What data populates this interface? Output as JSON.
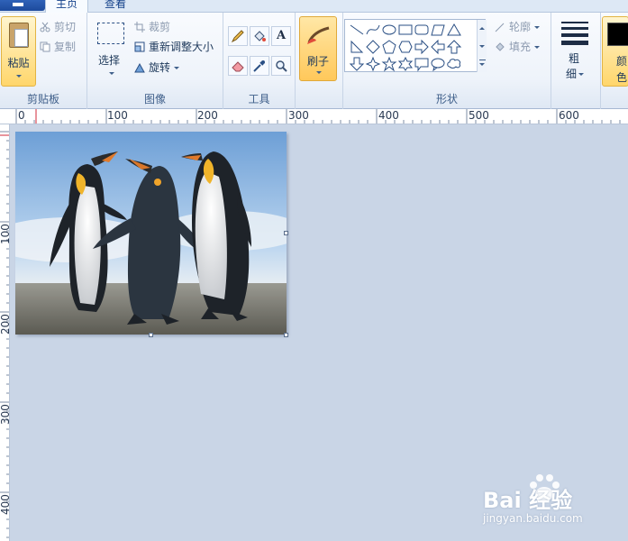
{
  "tabs": {
    "home": "主页",
    "view": "查看"
  },
  "clipboard": {
    "paste": "粘贴",
    "cut": "剪切",
    "copy": "复制",
    "group_label": "剪贴板"
  },
  "image": {
    "select": "选择",
    "crop": "裁剪",
    "resize": "重新调整大小",
    "rotate": "旋转",
    "group_label": "图像"
  },
  "tools": {
    "group_label": "工具",
    "text_tool": "A"
  },
  "brushes": {
    "label": "刷子"
  },
  "shapes": {
    "outline": "轮廓",
    "fill": "填充",
    "group_label": "形状"
  },
  "size": {
    "label_line1": "粗",
    "label_line2": "细"
  },
  "color": {
    "label_line1": "颜",
    "label_line2": "色",
    "color1": "#000000"
  },
  "ruler_h": [
    "0",
    "100",
    "200",
    "300",
    "400",
    "500",
    "600"
  ],
  "ruler_v": [
    "100",
    "200",
    "300",
    "400"
  ],
  "watermark": {
    "text": "Bai 经验",
    "sub": "jingyan.baidu.com"
  },
  "colors": {
    "ribbon_bg": "#eef3fa",
    "workspace_bg": "#c9d5e6",
    "accent_orange": "#ffc85a"
  }
}
